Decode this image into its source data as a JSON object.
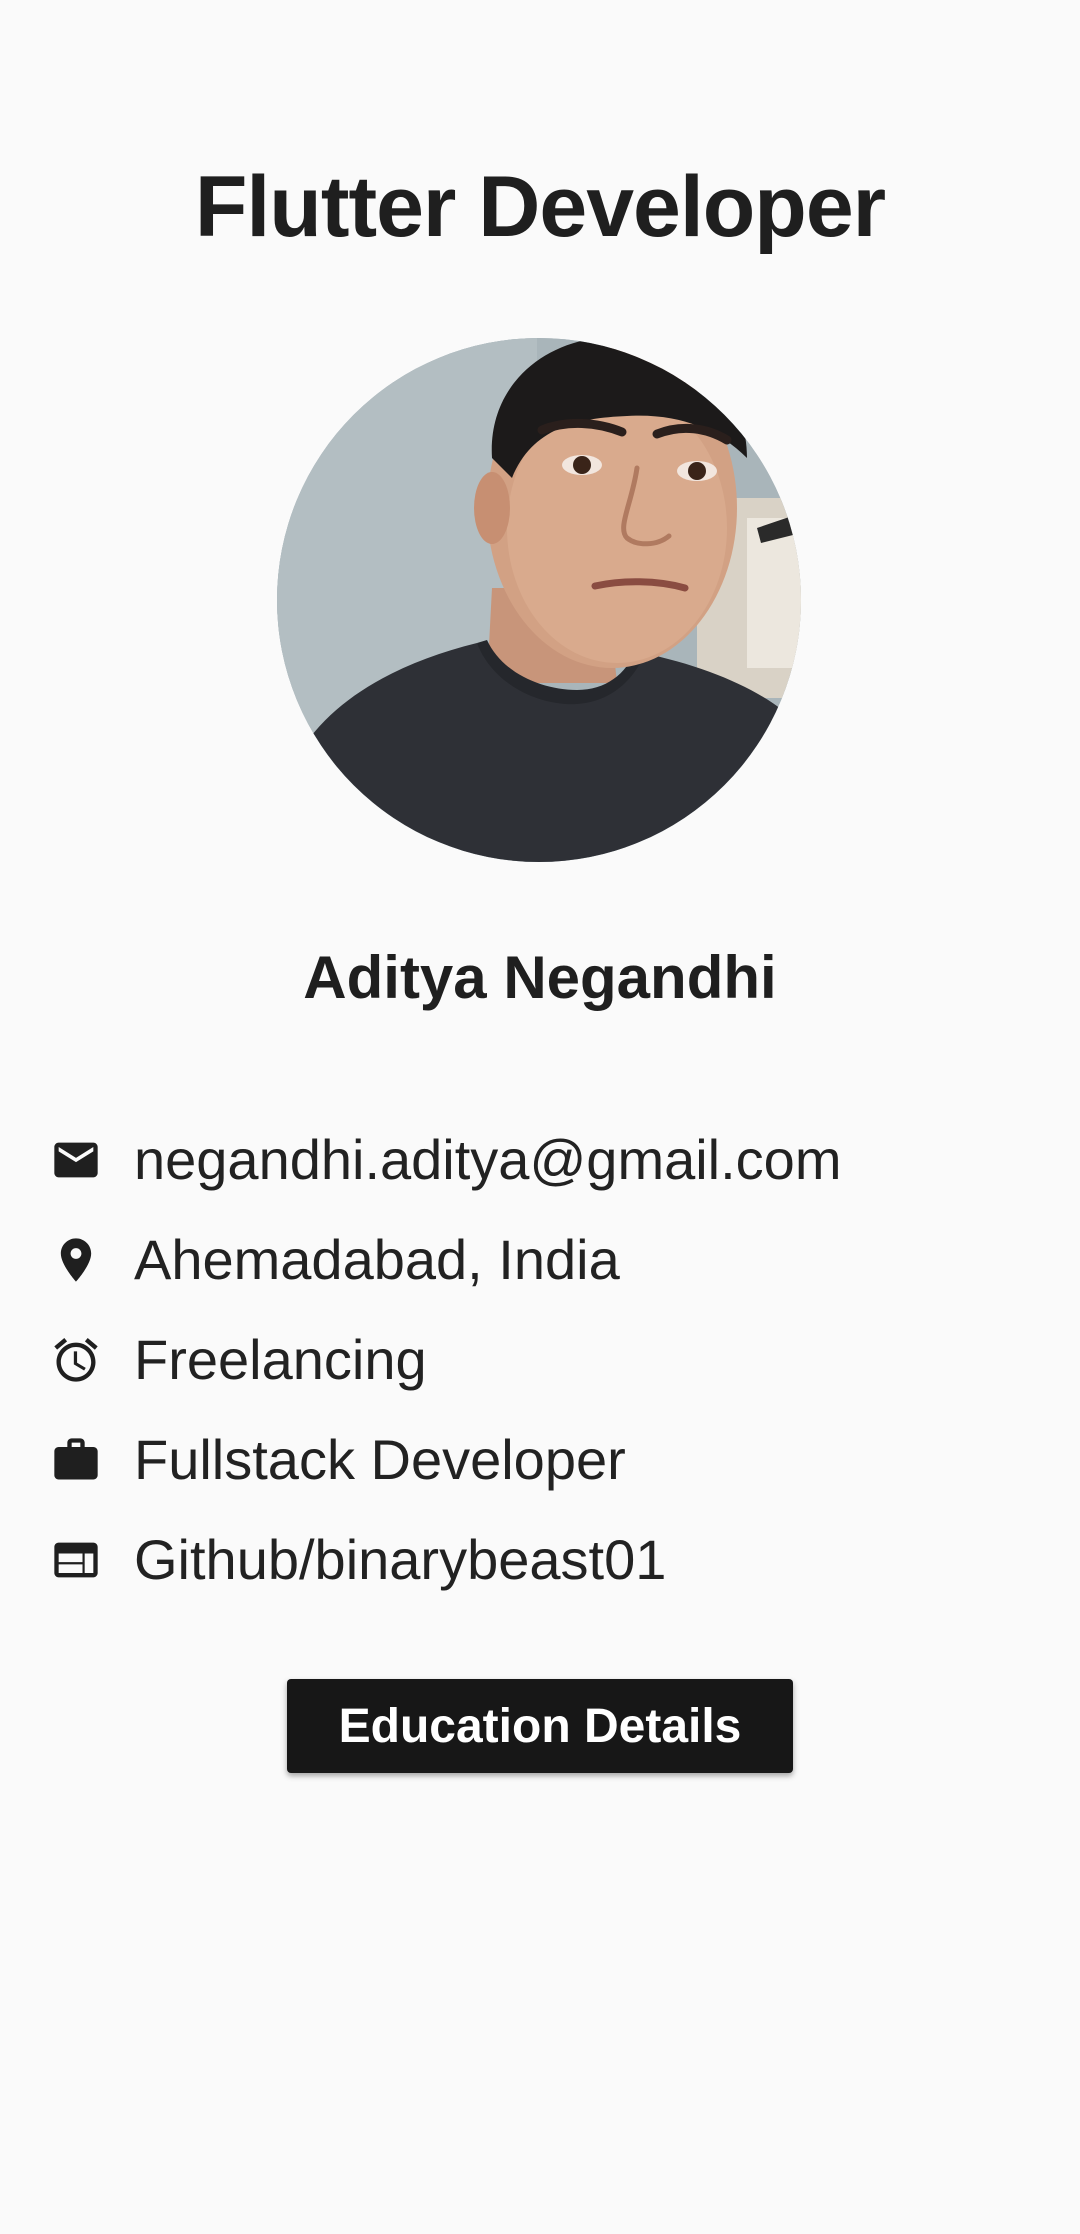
{
  "header": {
    "title": "Flutter Developer"
  },
  "profile": {
    "name": "Aditya Negandhi",
    "avatar_icon": "profile-photo"
  },
  "info": [
    {
      "icon": "mail-icon",
      "text": "negandhi.aditya@gmail.com"
    },
    {
      "icon": "location-pin-icon",
      "text": "Ahemadabad, India"
    },
    {
      "icon": "alarm-clock-icon",
      "text": "Freelancing"
    },
    {
      "icon": "briefcase-icon",
      "text": "Fullstack Developer"
    },
    {
      "icon": "web-card-icon",
      "text": "Github/binarybeast01"
    }
  ],
  "actions": {
    "education_label": "Education Details"
  },
  "colors": {
    "background": "#fafafa",
    "text": "#1f1f1f",
    "button_bg": "#171717",
    "button_text": "#ffffff"
  }
}
